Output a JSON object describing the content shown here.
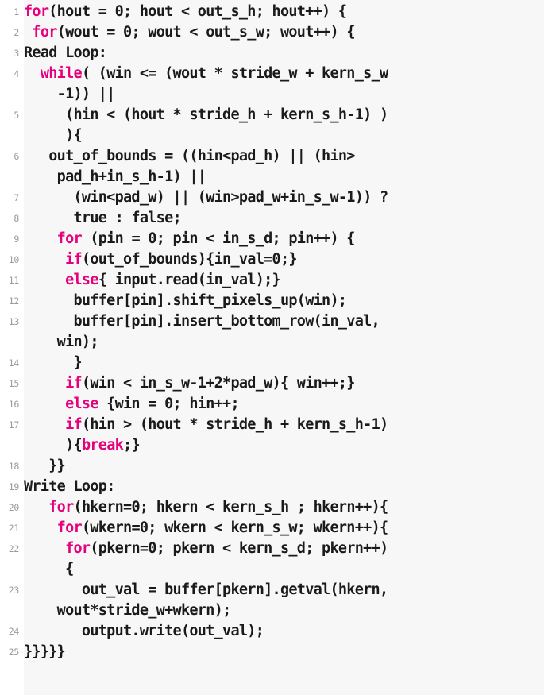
{
  "document": {
    "kind": "source-code-listing",
    "language": "C++",
    "keyword_color": "#e6007e",
    "text_color": "#1a1a1a",
    "lineno_color": "#9b9b9b",
    "background_color": "#f7f7f7",
    "gutter_color": "#ffffff",
    "line_count": 25
  },
  "lines": [
    {
      "number": "1",
      "segments": [
        {
          "kind": "keyword",
          "text": "for"
        },
        {
          "kind": "plain",
          "text": "(hout = 0; hout < out_s_h; hout++) {"
        }
      ]
    },
    {
      "number": "2",
      "segments": [
        {
          "kind": "plain",
          "text": " "
        },
        {
          "kind": "keyword",
          "text": "for"
        },
        {
          "kind": "plain",
          "text": "(wout = 0; wout < out_s_w; wout++) {"
        }
      ]
    },
    {
      "number": "3",
      "segments": [
        {
          "kind": "plain",
          "text": "Read Loop:"
        }
      ]
    },
    {
      "number": "4",
      "segments": [
        {
          "kind": "plain",
          "text": "  "
        },
        {
          "kind": "keyword",
          "text": "while"
        },
        {
          "kind": "plain",
          "text": "( (win <= (wout * stride_w + kern_s_w"
        }
      ]
    },
    {
      "number": "",
      "segments": [
        {
          "kind": "plain",
          "text": "    -1)) ||"
        }
      ]
    },
    {
      "number": "5",
      "segments": [
        {
          "kind": "plain",
          "text": "     (hin < (hout * stride_h + kern_s_h-1) )"
        }
      ]
    },
    {
      "number": "",
      "segments": [
        {
          "kind": "plain",
          "text": "     ){"
        }
      ]
    },
    {
      "number": "6",
      "segments": [
        {
          "kind": "plain",
          "text": "   out_of_bounds = ((hin<pad_h) || (hin>"
        }
      ]
    },
    {
      "number": "",
      "segments": [
        {
          "kind": "plain",
          "text": "    pad_h+in_s_h-1) ||"
        }
      ]
    },
    {
      "number": "7",
      "segments": [
        {
          "kind": "plain",
          "text": "      (win<pad_w) || (win>pad_w+in_s_w-1)) ?"
        }
      ]
    },
    {
      "number": "8",
      "segments": [
        {
          "kind": "plain",
          "text": "      true : false;"
        }
      ]
    },
    {
      "number": "9",
      "segments": [
        {
          "kind": "plain",
          "text": "    "
        },
        {
          "kind": "keyword",
          "text": "for"
        },
        {
          "kind": "plain",
          "text": " (pin = 0; pin < in_s_d; pin++) {"
        }
      ]
    },
    {
      "number": "10",
      "segments": [
        {
          "kind": "plain",
          "text": "     "
        },
        {
          "kind": "keyword",
          "text": "if"
        },
        {
          "kind": "plain",
          "text": "(out_of_bounds){in_val=0;}"
        }
      ]
    },
    {
      "number": "11",
      "segments": [
        {
          "kind": "plain",
          "text": "     "
        },
        {
          "kind": "keyword",
          "text": "else"
        },
        {
          "kind": "plain",
          "text": "{ input.read(in_val);}"
        }
      ]
    },
    {
      "number": "12",
      "segments": [
        {
          "kind": "plain",
          "text": "      buffer[pin].shift_pixels_up(win);"
        }
      ]
    },
    {
      "number": "13",
      "segments": [
        {
          "kind": "plain",
          "text": "      buffer[pin].insert_bottom_row(in_val,"
        }
      ]
    },
    {
      "number": "",
      "segments": [
        {
          "kind": "plain",
          "text": "    win);"
        }
      ]
    },
    {
      "number": "14",
      "segments": [
        {
          "kind": "plain",
          "text": "      }"
        }
      ]
    },
    {
      "number": "15",
      "segments": [
        {
          "kind": "plain",
          "text": "     "
        },
        {
          "kind": "keyword",
          "text": "if"
        },
        {
          "kind": "plain",
          "text": "(win < in_s_w-1+2*pad_w){ win++;}"
        }
      ]
    },
    {
      "number": "16",
      "segments": [
        {
          "kind": "plain",
          "text": "     "
        },
        {
          "kind": "keyword",
          "text": "else"
        },
        {
          "kind": "plain",
          "text": " {win = 0; hin++;"
        }
      ]
    },
    {
      "number": "17",
      "segments": [
        {
          "kind": "plain",
          "text": "     "
        },
        {
          "kind": "keyword",
          "text": "if"
        },
        {
          "kind": "plain",
          "text": "(hin > (hout * stride_h + kern_s_h-1)"
        }
      ]
    },
    {
      "number": "",
      "segments": [
        {
          "kind": "plain",
          "text": "     ){"
        },
        {
          "kind": "keyword",
          "text": "break"
        },
        {
          "kind": "plain",
          "text": ";}"
        }
      ]
    },
    {
      "number": "18",
      "segments": [
        {
          "kind": "plain",
          "text": "   }}"
        }
      ]
    },
    {
      "number": "19",
      "segments": [
        {
          "kind": "plain",
          "text": "Write Loop:"
        }
      ]
    },
    {
      "number": "20",
      "segments": [
        {
          "kind": "plain",
          "text": "   "
        },
        {
          "kind": "keyword",
          "text": "for"
        },
        {
          "kind": "plain",
          "text": "(hkern=0; hkern < kern_s_h ; hkern++){"
        }
      ]
    },
    {
      "number": "21",
      "segments": [
        {
          "kind": "plain",
          "text": "    "
        },
        {
          "kind": "keyword",
          "text": "for"
        },
        {
          "kind": "plain",
          "text": "(wkern=0; wkern < kern_s_w; wkern++){"
        }
      ]
    },
    {
      "number": "22",
      "segments": [
        {
          "kind": "plain",
          "text": "     "
        },
        {
          "kind": "keyword",
          "text": "for"
        },
        {
          "kind": "plain",
          "text": "(pkern=0; pkern < kern_s_d; pkern++)"
        }
      ]
    },
    {
      "number": "",
      "segments": [
        {
          "kind": "plain",
          "text": "     {"
        }
      ]
    },
    {
      "number": "23",
      "segments": [
        {
          "kind": "plain",
          "text": "       out_val = buffer[pkern].getval(hkern,"
        }
      ]
    },
    {
      "number": "",
      "segments": [
        {
          "kind": "plain",
          "text": "    wout*stride_w+wkern);"
        }
      ]
    },
    {
      "number": "24",
      "segments": [
        {
          "kind": "plain",
          "text": "       output.write(out_val);"
        }
      ]
    },
    {
      "number": "25",
      "segments": [
        {
          "kind": "plain",
          "text": "}}}}}"
        }
      ]
    }
  ]
}
